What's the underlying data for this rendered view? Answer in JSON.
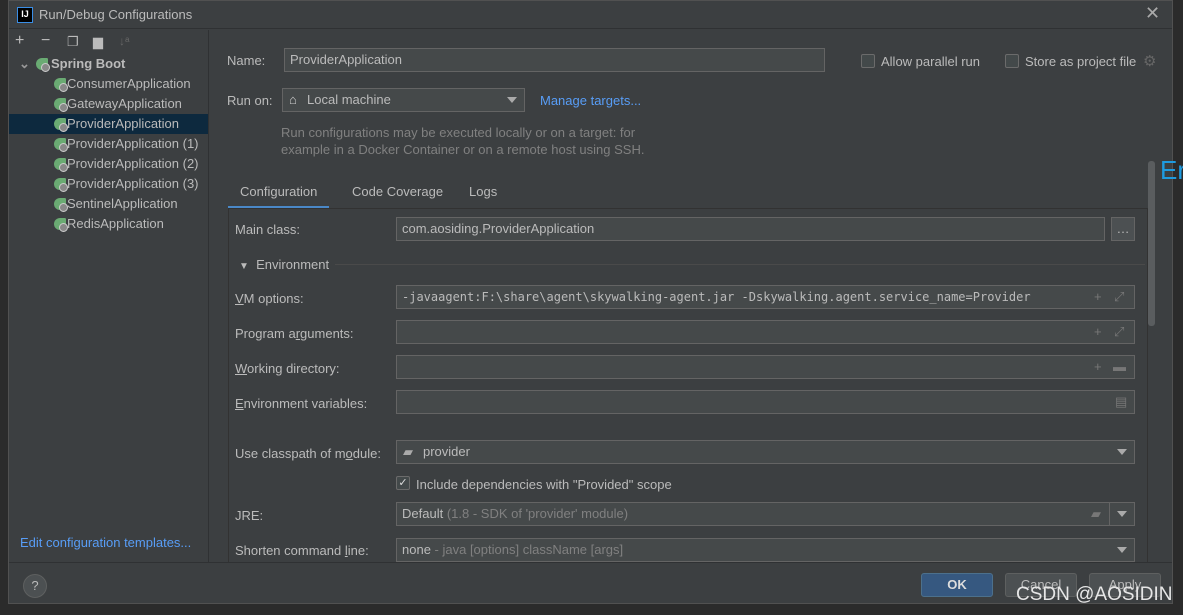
{
  "window": {
    "title": "Run/Debug Configurations",
    "logo": "IJ"
  },
  "toolbar": {
    "icons": [
      "plus-icon",
      "minus-icon",
      "copy-icon",
      "new-folder-icon",
      "sort-icon"
    ]
  },
  "tree": {
    "group": "Spring Boot",
    "items": [
      {
        "label": "ConsumerApplication",
        "selected": false
      },
      {
        "label": "GatewayApplication",
        "selected": false
      },
      {
        "label": "ProviderApplication",
        "selected": true
      },
      {
        "label": "ProviderApplication (1)",
        "selected": false
      },
      {
        "label": "ProviderApplication (2)",
        "selected": false
      },
      {
        "label": "ProviderApplication (3)",
        "selected": false
      },
      {
        "label": "SentinelApplication",
        "selected": false
      },
      {
        "label": "RedisApplication",
        "selected": false
      }
    ]
  },
  "edit_templates": "Edit configuration templates...",
  "form": {
    "name_label": "Name:",
    "name_value": "ProviderApplication",
    "allow_parallel": "Allow parallel run",
    "store_project": "Store as project file",
    "run_on_label": "Run on:",
    "run_on_value": "Local machine",
    "manage_targets": "Manage targets...",
    "hint": "Run configurations may be executed locally or on a target: for example in a Docker Container or on a remote host using SSH.",
    "tabs": [
      "Configuration",
      "Code Coverage",
      "Logs"
    ],
    "main_class_label": "Main class:",
    "main_class_value": "com.aosiding.ProviderApplication",
    "environment": "Environment",
    "vm_label": "VM options:",
    "vm_value": "-javaagent:F:\\share\\agent\\skywalking-agent.jar -Dskywalking.agent.service_name=Provider",
    "args_label": "Program arguments:",
    "workdir_label": "Working directory:",
    "env_label": "Environment variables:",
    "module_label": "Use classpath of module:",
    "module_value": "provider",
    "include_deps": "Include dependencies with \"Provided\" scope",
    "include_deps_checked": true,
    "jre_label": "JRE:",
    "jre_value": "Default",
    "jre_hint": "(1.8 - SDK of 'provider' module)",
    "shorten_label": "Shorten command line:",
    "shorten_value": "none",
    "shorten_hint": "- java [options] className [args]"
  },
  "buttons": {
    "help": "?",
    "ok": "OK",
    "cancel": "Cancel",
    "apply": "Apply"
  },
  "watermark": "CSDN @AOSIDIN",
  "colors": {
    "accent": "#589df6",
    "ok": "#365880",
    "selection": "#0d293e"
  }
}
